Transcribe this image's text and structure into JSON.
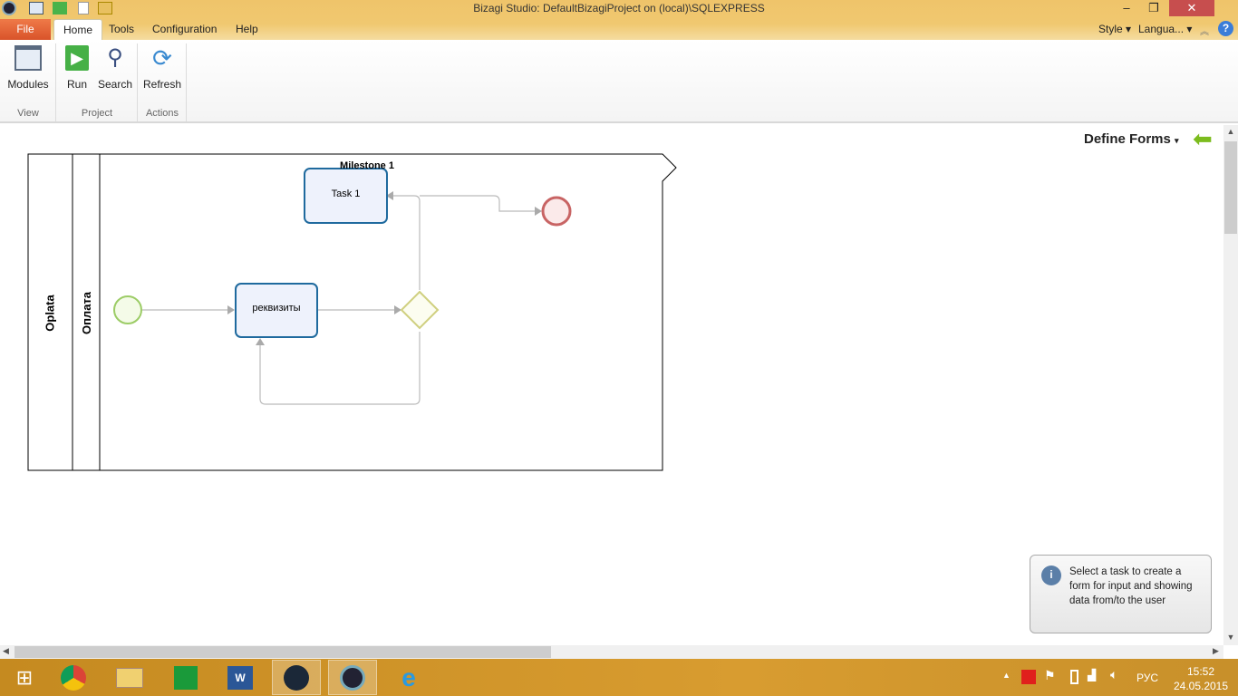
{
  "window": {
    "title": "Bizagi Studio: DefaultBizagiProject on (local)\\SQLEXPRESS",
    "minimize": "–",
    "maximize": "❐",
    "close": "✕"
  },
  "menu": {
    "tabs": [
      "File",
      "Home",
      "Tools",
      "Configuration",
      "Help"
    ],
    "style": "Style",
    "language": "Langua...",
    "help_icon": "?"
  },
  "ribbon": {
    "buttons": {
      "modules": "Modules",
      "run": "Run",
      "search": "Search",
      "refresh": "Refresh"
    },
    "groups": {
      "view": "View",
      "project": "Project",
      "actions": "Actions"
    }
  },
  "header": {
    "define_forms": "Define Forms"
  },
  "diagram": {
    "pool": "Oplata",
    "lane": "Оплата",
    "milestone": "Milestone 1",
    "task1": "Task 1",
    "task2": "реквизиты"
  },
  "info": {
    "text": "Select a task to create a form for input and showing data from/to the user"
  },
  "taskbar": {
    "lang": "РУС",
    "time": "15:52",
    "date": "24.05.2015"
  }
}
